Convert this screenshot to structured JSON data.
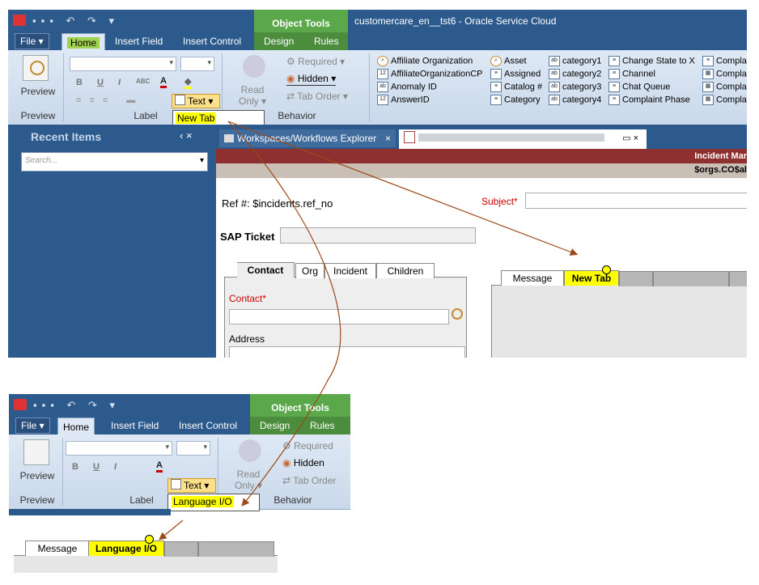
{
  "window": {
    "title": "customercare_en__tst6  -  Oracle Service Cloud"
  },
  "ribbon": {
    "file_label": "File ▾",
    "tabs": [
      "Home",
      "Insert Field",
      "Insert Control",
      "Design",
      "Rules"
    ],
    "object_tools_label": "Object Tools",
    "preview_label": "Preview",
    "preview_group": "Preview",
    "label_group": "Label",
    "behavior_group": "Behavior",
    "text_button": "Text ▾",
    "read_only": "Read\nOnly ▾",
    "required": "Required",
    "hidden": "Hidden",
    "tab_order": "Tab Order",
    "fields": [
      [
        "Affiliate Organization",
        "Asset",
        "category1",
        "Change State to X",
        "Compla"
      ],
      [
        "AffiliateOrganizationCP",
        "Assigned",
        "category2",
        "Channel",
        "Compla"
      ],
      [
        "Anomaly ID",
        "Catalog #",
        "category3",
        "Chat Queue",
        "Compla"
      ],
      [
        "AnswerID",
        "Category",
        "category4",
        "Complaint Phase",
        "Compla"
      ]
    ]
  },
  "edit_box_1": {
    "value": "New Tab"
  },
  "edit_box_2": {
    "value": "Language I/O"
  },
  "left_panel": {
    "title": "Recent Items",
    "controls": "‹ ×",
    "search_placeholder": "Search..."
  },
  "doc_tabs": {
    "explorer": "Workspaces/Workflows Explorer",
    "close": "×",
    "doc_controls": "▭ ×"
  },
  "form": {
    "header_right_1": "Incident Mar",
    "header_right_2": "$orgs.CO$al",
    "ref_label": "Ref #:  $incidents.ref_no",
    "subject_label": "Subject*",
    "sap_label": "SAP Ticket",
    "left_tabs": [
      "Contact",
      "Org",
      "Incident",
      "Children"
    ],
    "contact_label": "Contact*",
    "address_label": "Address",
    "right_tabs_1": [
      "Message",
      "New Tab"
    ],
    "right_tabs_2": [
      "Message",
      "Language I/O"
    ]
  },
  "colors": {
    "ribbon_blue": "#2c5a8c",
    "highlight": "#ffff00",
    "arrow": "#9c4a1a",
    "object_tools": "#5aa84a"
  }
}
